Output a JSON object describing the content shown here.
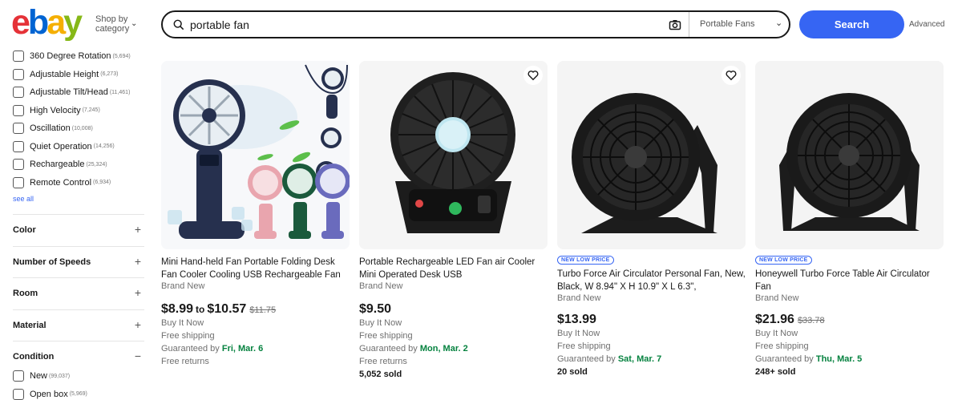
{
  "brand": {
    "logo": [
      "e",
      "b",
      "a",
      "y"
    ],
    "logo_colors": [
      "#e53238",
      "#0064d2",
      "#f5af02",
      "#86b817"
    ]
  },
  "header": {
    "shop_by": "Shop by category",
    "search_value": "portable fan",
    "category": "Portable Fans",
    "search_label": "Search",
    "advanced": "Advanced"
  },
  "sidebar": {
    "features": [
      {
        "label": "360 Degree Rotation",
        "count": "(5,694)"
      },
      {
        "label": "Adjustable Height",
        "count": "(6,273)"
      },
      {
        "label": "Adjustable Tilt/Head",
        "count": "(11,461)"
      },
      {
        "label": "High Velocity",
        "count": "(7,245)"
      },
      {
        "label": "Oscillation",
        "count": "(10,008)"
      },
      {
        "label": "Quiet Operation",
        "count": "(14,256)"
      },
      {
        "label": "Rechargeable",
        "count": "(25,324)"
      },
      {
        "label": "Remote Control",
        "count": "(6,934)"
      }
    ],
    "see_all": "see all",
    "sections": [
      {
        "title": "Color",
        "toggle": "+"
      },
      {
        "title": "Number of Speeds",
        "toggle": "+"
      },
      {
        "title": "Room",
        "toggle": "+"
      },
      {
        "title": "Material",
        "toggle": "+"
      },
      {
        "title": "Condition",
        "toggle": "−"
      }
    ],
    "condition": [
      {
        "label": "New",
        "count": "(99,037)"
      },
      {
        "label": "Open box",
        "count": "(5,969)"
      }
    ]
  },
  "products": [
    {
      "title": "Mini Hand-held Fan Portable Folding Desk Fan Cooler Cooling USB Rechargeable Fan",
      "condition": "Brand New",
      "price_low": "$8.99",
      "to": "to",
      "price_high": "$10.57",
      "was": "$11.75",
      "buy": "Buy It Now",
      "shipping": "Free shipping",
      "guaranteed": "Guaranteed by",
      "date": "Fri, Mar. 6",
      "returns": "Free returns"
    },
    {
      "title": "Portable Rechargeable LED Fan air Cooler Mini Operated Desk USB",
      "condition": "Brand New",
      "price": "$9.50",
      "buy": "Buy It Now",
      "shipping": "Free shipping",
      "guaranteed": "Guaranteed by",
      "date": "Mon, Mar. 2",
      "returns": "Free returns",
      "sold": "5,052 sold"
    },
    {
      "badge": "NEW LOW PRICE",
      "title": "Turbo Force Air Circulator Personal Fan, New, Black, W 8.94\" X H 10.9\" X L 6.3\",",
      "condition": "Brand New",
      "price": "$13.99",
      "buy": "Buy It Now",
      "shipping": "Free shipping",
      "guaranteed": "Guaranteed by",
      "date": "Sat, Mar. 7",
      "sold": "20 sold"
    },
    {
      "badge": "NEW LOW PRICE",
      "title": "Honeywell Turbo Force Table Air Circulator Fan",
      "condition": "Brand New",
      "price": "$21.96",
      "was": "$33.78",
      "buy": "Buy It Now",
      "shipping": "Free shipping",
      "guaranteed": "Guaranteed by",
      "date": "Thu, Mar. 5",
      "sold": "248+ sold"
    }
  ]
}
